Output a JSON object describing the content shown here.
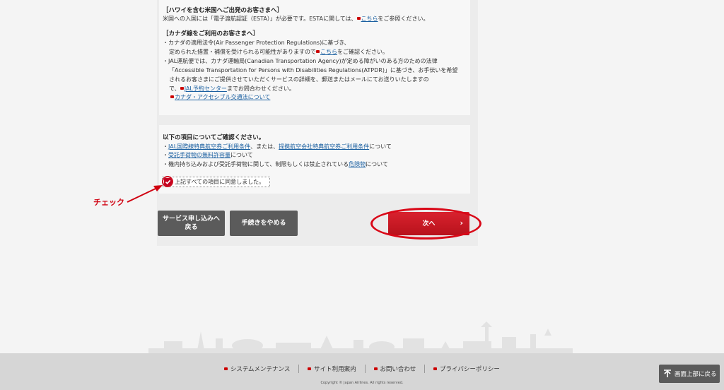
{
  "top_panel": {
    "heading_hawaii": "［ハワイを含む米国へご出発のお客さまへ］",
    "esta_text_before": "米国への入国には「電子渡航認証（ESTA）」が必要です。ESTAに関しては、",
    "esta_link": "こちら",
    "esta_text_after": "をご参照ください。",
    "heading_canada": "［カナダ線をご利用のお客さまへ］",
    "canada_line1": "・カナダの適用法令(Air Passenger Protection Regulations)に基づき、",
    "canada_line2_before": "定められた措置・補償を受けられる可能性がありますので",
    "canada_line2_link": "こちら",
    "canada_line2_after": "をご確認ください。",
    "canada_line3": "・JAL運航便では、カナダ運輸局(Canadian Transportation Agency)が定める障がいのある方のための法律",
    "canada_line4": "「Accessible Transportation for Persons with Disabilities Regulations(ATPDR)」に基づき、お手伝いを希望",
    "canada_line5": "されるお客さまにご提供させていただくサービスの詳細を、郵送またはメールにてお送りいたしますの",
    "canada_line6_before": "で、",
    "canada_line6_link": "JAL予約センター",
    "canada_line6_after": "までお問合わせください。",
    "canada_link2": "カナダ・アクセシブル交通法について"
  },
  "confirm_panel": {
    "heading": "以下の項目についてご確認ください。",
    "item1_link1": "JAL国際線特典航空券ご利用条件",
    "item1_mid": "、または、",
    "item1_link2": "提携航空会社特典航空券ご利用条件",
    "item1_after": "について",
    "item2_link": "受託手荷物の無料許容量",
    "item2_after": "について",
    "item3_before": "・機内持ち込みおよび受託手荷物に関して、制限もしくは禁止されている",
    "item3_link": "危険物",
    "item3_after": "について",
    "agree_label": "上記すべての項目に同意しました。",
    "agree_checked": true
  },
  "annotation": {
    "check_label": "チェック"
  },
  "buttons": {
    "back_line1": "サービス申し込みへ",
    "back_line2": "戻る",
    "cancel": "手続きをやめる",
    "next": "次へ",
    "next_chevron": "›"
  },
  "footer": {
    "links": [
      "システムメンテナンス",
      "サイト利用案内",
      "お問い合わせ",
      "プライバシーポリシー"
    ],
    "copyright": "Copyright © Japan Airlines. All rights reserved.",
    "back_to_top": "画面上部に戻る"
  },
  "colors": {
    "brand_red": "#c40022",
    "button_gray": "#5b5b5b",
    "link_blue": "#1a5fa0"
  }
}
